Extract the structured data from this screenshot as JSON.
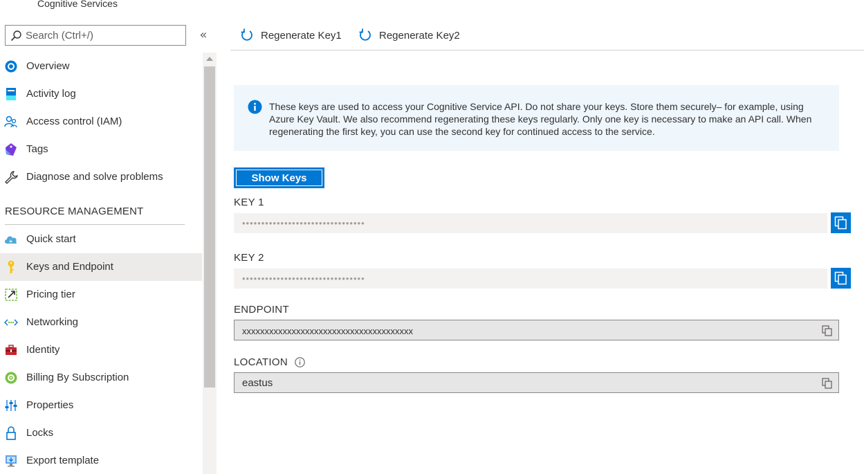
{
  "service": {
    "title": "Cognitive Services"
  },
  "search": {
    "placeholder": "Search (Ctrl+/)",
    "collapse_glyph": "«"
  },
  "sidebar": {
    "items_top": [
      {
        "label": "Overview",
        "icon": "overview-icon"
      },
      {
        "label": "Activity log",
        "icon": "activity-log-icon"
      },
      {
        "label": "Access control (IAM)",
        "icon": "access-control-icon"
      },
      {
        "label": "Tags",
        "icon": "tag-icon"
      },
      {
        "label": "Diagnose and solve problems",
        "icon": "wrench-icon"
      }
    ],
    "section_header": "RESOURCE MANAGEMENT",
    "items_resource": [
      {
        "label": "Quick start",
        "icon": "quick-start-icon"
      },
      {
        "label": "Keys and Endpoint",
        "icon": "key-icon",
        "active": true
      },
      {
        "label": "Pricing tier",
        "icon": "pricing-tier-icon"
      },
      {
        "label": "Networking",
        "icon": "networking-icon"
      },
      {
        "label": "Identity",
        "icon": "identity-icon"
      },
      {
        "label": "Billing By Subscription",
        "icon": "billing-icon"
      },
      {
        "label": "Properties",
        "icon": "properties-icon"
      },
      {
        "label": "Locks",
        "icon": "lock-icon"
      },
      {
        "label": "Export template",
        "icon": "export-template-icon"
      }
    ]
  },
  "toolbar": {
    "regenerate_key1": "Regenerate Key1",
    "regenerate_key2": "Regenerate Key2"
  },
  "info": {
    "message": "These keys are used to access your Cognitive Service API. Do not share your keys. Store them securely– for example, using Azure Key Vault. We also recommend regenerating these keys regularly. Only one key is necessary to make an API call. When regenerating the first key, you can use the second key for continued access to the service."
  },
  "keys": {
    "show_keys_label": "Show Keys",
    "key1_label": "KEY 1",
    "key1_value": "••••••••••••••••••••••••••••••••",
    "key2_label": "KEY 2",
    "key2_value": "••••••••••••••••••••••••••••••••",
    "endpoint_label": "ENDPOINT",
    "endpoint_value": "xxxxxxxxxxxxxxxxxxxxxxxxxxxxxxxxxxxxxx",
    "location_label": "LOCATION",
    "location_value": "eastus"
  },
  "colors": {
    "accent": "#0078d4",
    "info_bg": "#eff6fc",
    "active_item_bg": "#edebe9"
  }
}
